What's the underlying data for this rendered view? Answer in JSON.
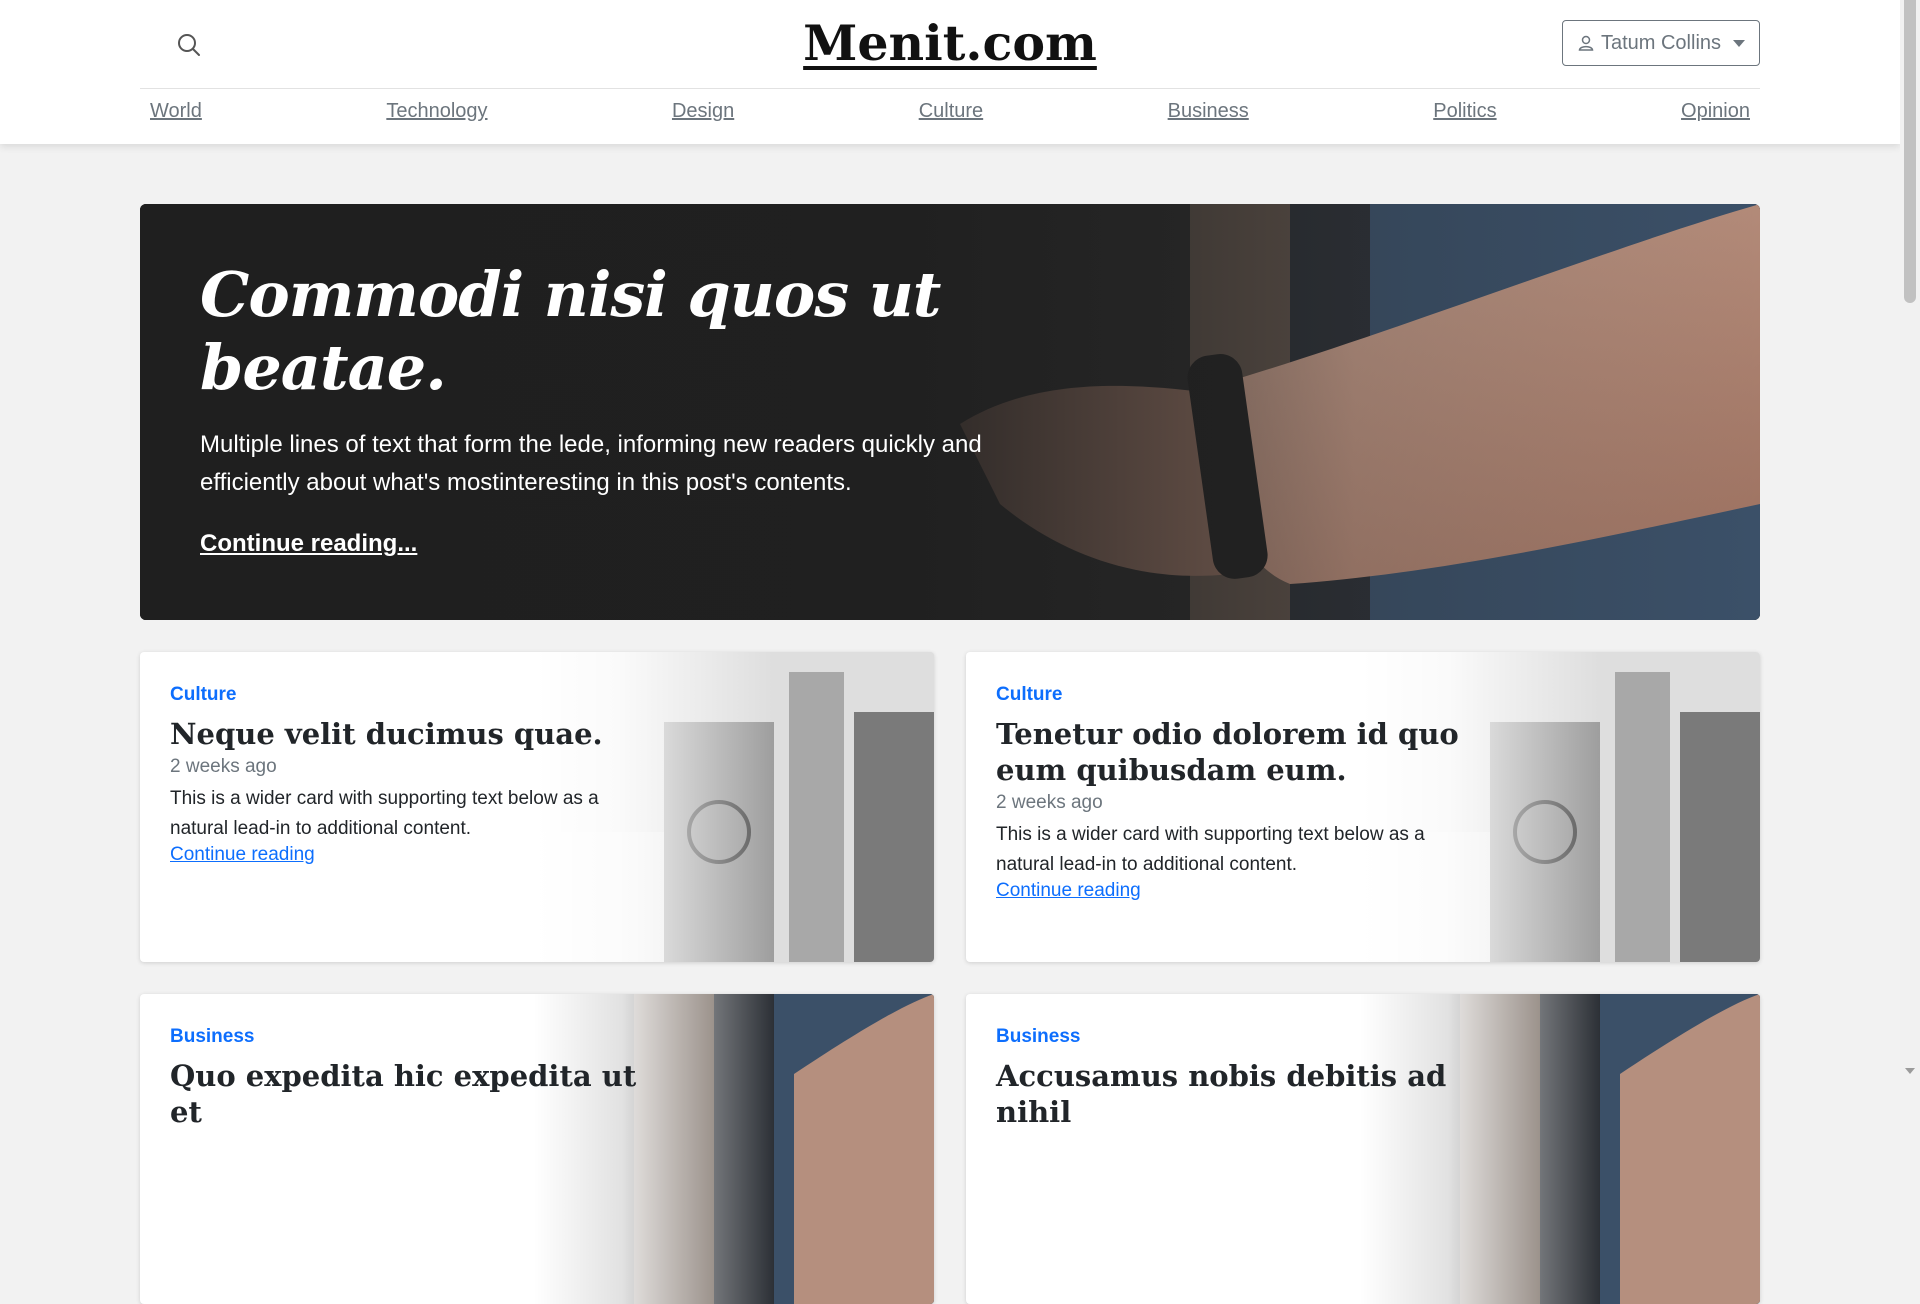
{
  "header": {
    "brand": "Menit.com",
    "user_name": "Tatum Collins",
    "nav": [
      "World",
      "Technology",
      "Design",
      "Culture",
      "Business",
      "Politics",
      "Opinion"
    ]
  },
  "hero": {
    "title": "Commodi nisi quos ut beatae.",
    "lede": "Multiple lines of text that form the lede, informing new readers quickly and efficiently about what's mostinteresting in this post's contents.",
    "link": "Continue reading..."
  },
  "cards": [
    {
      "category": "Culture",
      "title": "Neque velit ducimus quae.",
      "time": "2 weeks ago",
      "text": "This is a wider card with supporting text below as a natural lead-in to additional content.",
      "link": "Continue reading"
    },
    {
      "category": "Culture",
      "title": "Tenetur odio dolorem id quo eum quibusdam eum.",
      "time": "2 weeks ago",
      "text": "This is a wider card with supporting text below as a natural lead-in to additional content.",
      "link": "Continue reading"
    },
    {
      "category": "Business",
      "title": "Quo expedita hic expedita ut et"
    },
    {
      "category": "Business",
      "title": "Accusamus nobis debitis ad nihil"
    }
  ],
  "colors": {
    "accent": "#0d6efd",
    "muted": "#6c757d",
    "hero_bg": "#1f1f1f"
  }
}
